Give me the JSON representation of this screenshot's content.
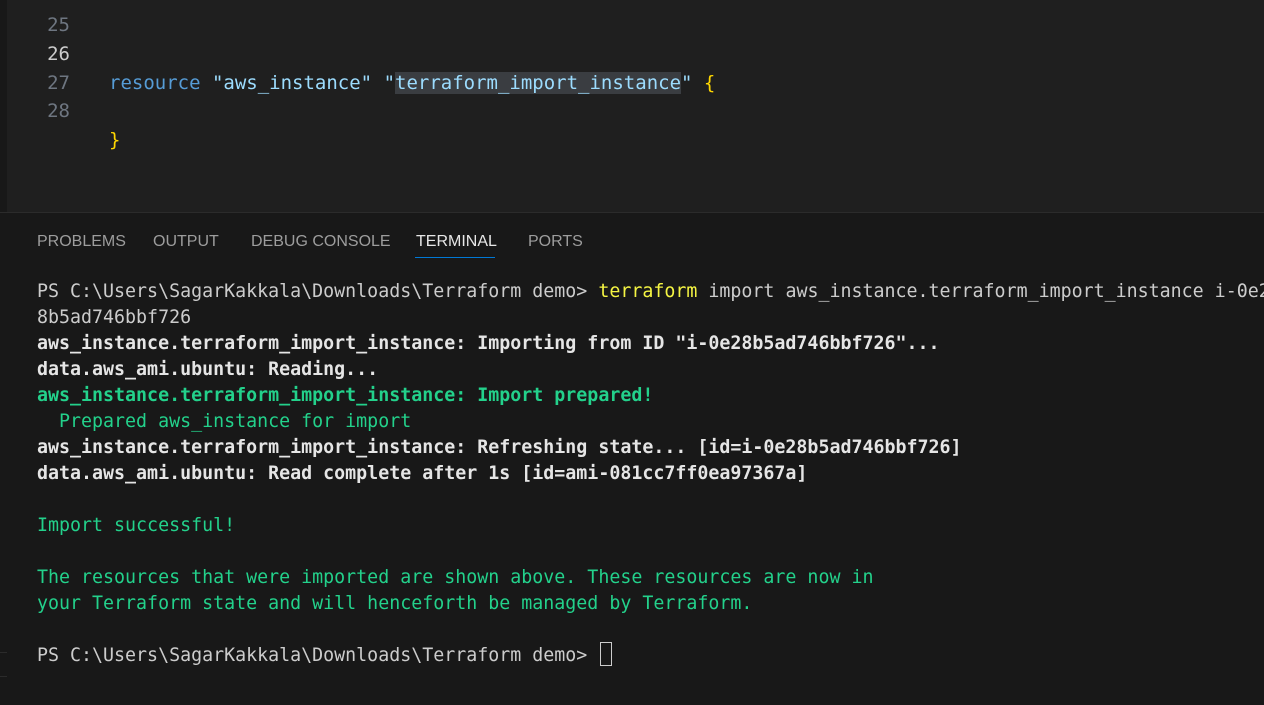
{
  "editor": {
    "lines": [
      {
        "num": "26",
        "keyword": "resource",
        "type_string": "\"aws_instance\"",
        "name_open_quote": "\"",
        "name_selected": "terraform_import_instance",
        "name_close_quote": "\"",
        "brace": "{"
      },
      {
        "num": "27"
      },
      {
        "num": "28",
        "brace": "}"
      }
    ]
  },
  "panel": {
    "tabs": [
      {
        "label": "PROBLEMS"
      },
      {
        "label": "OUTPUT"
      },
      {
        "label": "DEBUG CONSOLE"
      },
      {
        "label": "TERMINAL",
        "active": true
      },
      {
        "label": "PORTS"
      }
    ]
  },
  "terminal": {
    "prompt": "PS C:\\Users\\SagarKakkala\\Downloads\\Terraform demo> ",
    "command_name": "terraform",
    "command_args": " import aws_instance.terraform_import_instance i-0e2",
    "wrap_line": "8b5ad746bbf726",
    "line_importing": "aws_instance.terraform_import_instance: Importing from ID \"i-0e28b5ad746bbf726\"...",
    "line_reading": "data.aws_ami.ubuntu: Reading...",
    "line_prepared": "aws_instance.terraform_import_instance: Import prepared!",
    "line_prepared_detail": "  Prepared aws_instance for import",
    "line_refreshing": "aws_instance.terraform_import_instance: Refreshing state... [id=i-0e28b5ad746bbf726]",
    "line_read_complete": "data.aws_ami.ubuntu: Read complete after 1s [id=ami-081cc7ff0ea97367a]",
    "line_success": "Import successful!",
    "line_info_1": "The resources that were imported are shown above. These resources are now in",
    "line_info_2": "your Terraform state and will henceforth be managed by Terraform.",
    "final_prompt": "PS C:\\Users\\SagarKakkala\\Downloads\\Terraform demo> "
  },
  "colors": {
    "background": "#1f1f1f",
    "panel_background": "#181818",
    "active_tab_underline": "#0078d4",
    "success_green": "#23d18b",
    "command_yellow": "#f5f543"
  }
}
